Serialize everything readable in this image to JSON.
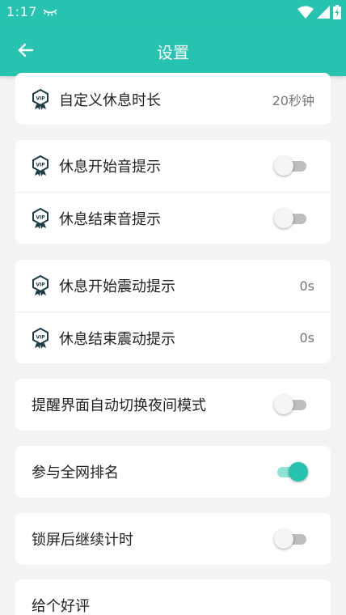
{
  "status_bar": {
    "time": "1:17"
  },
  "app_bar": {
    "title": "设置"
  },
  "settings": {
    "rest_duration": {
      "label": "自定义休息时长",
      "value": "20秒钟"
    },
    "rest_start_sound": {
      "label": "休息开始音提示",
      "enabled": false
    },
    "rest_end_sound": {
      "label": "休息结束音提示",
      "enabled": false
    },
    "rest_start_vibrate": {
      "label": "休息开始震动提示",
      "value": "0s"
    },
    "rest_end_vibrate": {
      "label": "休息结束震动提示",
      "value": "0s"
    },
    "auto_night_mode": {
      "label": "提醒界面自动切换夜间模式",
      "enabled": false
    },
    "global_ranking": {
      "label": "参与全网排名",
      "enabled": true
    },
    "continue_after_lock": {
      "label": "锁屏后继续计时",
      "enabled": false
    },
    "rate_us": {
      "label": "给个好评"
    }
  },
  "colors": {
    "accent": "#26c4b0",
    "toggle_on_track": "#8fe3d6",
    "toggle_off_track": "#bdbdbd"
  }
}
